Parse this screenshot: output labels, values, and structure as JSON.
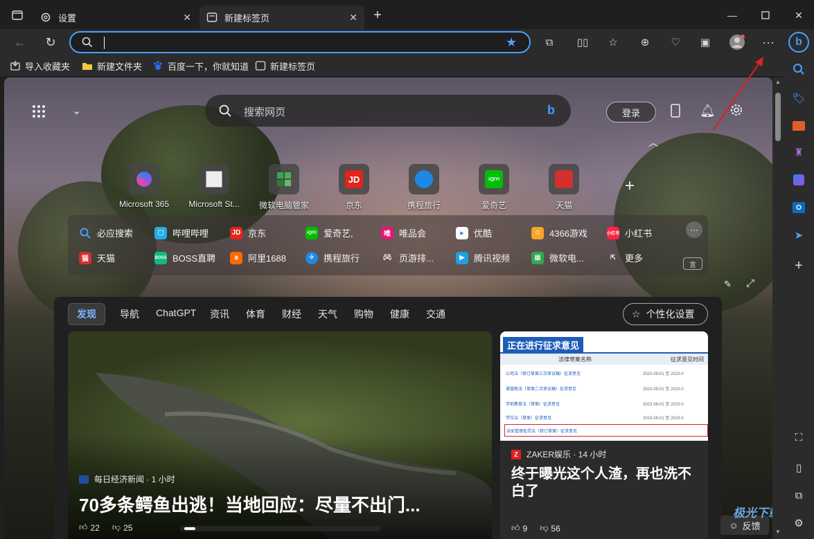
{
  "tabs": [
    {
      "label": "设置",
      "icon": "gear-icon",
      "active": false
    },
    {
      "label": "新建标签页",
      "icon": "newtab-icon",
      "active": true
    }
  ],
  "address": {
    "value": ""
  },
  "favorites": [
    {
      "label": "导入收藏夹",
      "icon": "import-icon"
    },
    {
      "label": "新建文件夹",
      "icon": "folder-icon"
    },
    {
      "label": "百度一下，你就知道",
      "icon": "baidu-icon"
    },
    {
      "label": "新建标签页",
      "icon": "newtab-icon"
    }
  ],
  "search": {
    "placeholder": "搜索网页"
  },
  "login_label": "登录",
  "quick_links": [
    {
      "label": "Microsoft 365",
      "icon": "m365-icon",
      "color": "#6b5bd2"
    },
    {
      "label": "Microsoft St...",
      "icon": "msstore-icon",
      "color": "#d9d9d9"
    },
    {
      "label": "微软电脑管家",
      "icon": "pcmanager-icon",
      "color": "#34a853"
    },
    {
      "label": "京东",
      "icon": "jd-icon",
      "color": "#e1251b"
    },
    {
      "label": "携程旅行",
      "icon": "ctrip-icon",
      "color": "#1e88e5"
    },
    {
      "label": "爱奇艺",
      "icon": "iqiyi-icon",
      "color": "#00be06"
    },
    {
      "label": "天猫",
      "icon": "tmall-icon",
      "color": "#d32f2f"
    }
  ],
  "sites_row1": [
    "必应搜索",
    "哔哩哔哩",
    "京东",
    "爱奇艺,",
    "唯品会",
    "优酷",
    "4366游戏",
    "小红书"
  ],
  "sites_row2": [
    "天猫",
    "BOSS直聘",
    "阿里1688",
    "携程旅行",
    "页游排...",
    "腾讯视频",
    "微软电...",
    "更多"
  ],
  "feed_tabs": [
    "发现",
    "导航",
    "ChatGPT",
    "资讯",
    "体育",
    "财经",
    "天气",
    "购物",
    "健康",
    "交通"
  ],
  "personalize_label": "个性化设置",
  "main_story": {
    "source": "每日经济新闻 · 1 小时",
    "title": "70多条鳄鱼出逃！当地回应：尽量不出门...",
    "likes": "22",
    "dislikes": "25"
  },
  "side_story": {
    "banner": "正在进行征求意见",
    "table_header_1": "法律草案名称",
    "table_header_2": "征求意见时间",
    "rows": [
      "公司法（修订草案三次审议稿）征求意见",
      "增值税法（草案二次审议稿）征求意见",
      "学前教育法（草案）征求意见",
      "学位法（草案）征求意见",
      "治安管理处罚法（修订草案）征求意见"
    ],
    "row_date": "2023-09-01 至 2023-0",
    "source": "ZAKER娱乐 · 14 小时",
    "title": "终于曝光这个人渣，再也洗不白了",
    "likes": "9",
    "dislikes": "56"
  },
  "feedback_label": "反馈",
  "watermark": "极光下载站"
}
